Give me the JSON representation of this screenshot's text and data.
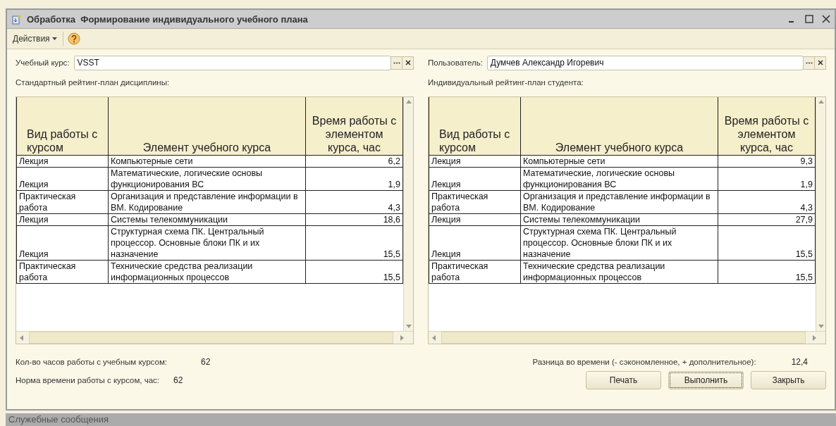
{
  "window": {
    "title_kind": "Обработка",
    "title": "Формирование индивидуального учебного плана"
  },
  "toolbar": {
    "actions_menu": "Действия"
  },
  "fields": [
    {
      "label": "Учебный курс:",
      "value": "VSST"
    },
    {
      "label": "Пользователь:",
      "value": "Думчев Александр Игоревич"
    }
  ],
  "tables": [
    {
      "caption": "Стандартный рейтинг-план дисциплины:",
      "columns": [
        "Вид работы с курсом",
        "Элемент учебного курса",
        "Время работы с элементом курса, час"
      ],
      "rows": [
        [
          "Лекция",
          "Компьютерные сети",
          "6,2"
        ],
        [
          "Лекция",
          "Математические, логические основы функционирования ВС",
          "1,9"
        ],
        [
          "Практическая работа",
          "Организация и представление информации в ВМ. Кодирование",
          "4,3"
        ],
        [
          "Лекция",
          "Системы телекоммуникации",
          "18,6"
        ],
        [
          "Лекция",
          "Структурная схема ПК. Центральный процессор. Основные блоки ПК и их назначение",
          "15,5"
        ],
        [
          "Практическая работа",
          "Технические средства реализации информационных процессов",
          "15,5"
        ]
      ]
    },
    {
      "caption": "Индивидуальный рейтинг-план студента:",
      "columns": [
        "Вид работы с курсом",
        "Элемент учебного курса",
        "Время работы с элементом курса, час"
      ],
      "rows": [
        [
          "Лекция",
          "Компьютерные сети",
          "9,3"
        ],
        [
          "Лекция",
          "Математические, логические основы функционирования ВС",
          "1,9"
        ],
        [
          "Практическая работа",
          "Организация и представление информации в ВМ. Кодирование",
          "4,3"
        ],
        [
          "Лекция",
          "Системы телекоммуникации",
          "27,9"
        ],
        [
          "Лекция",
          "Структурная схема ПК. Центральный процессор. Основные блоки ПК и их назначение",
          "15,5"
        ],
        [
          "Практическая работа",
          "Технические средства реализации информационных процессов",
          "15,5"
        ]
      ]
    }
  ],
  "totals": [
    {
      "label": "Кол-во часов работы с учебным курсом:",
      "value": "62"
    },
    {
      "label": "Норма времени работы с курсом, час:",
      "value": "62"
    }
  ],
  "difference": {
    "label": "Разница во времени (- сэкономленное, + дополнительное):",
    "value": "12,4"
  },
  "buttons": [
    {
      "label": "Печать",
      "focused": false
    },
    {
      "label": "Выполнить",
      "focused": true
    },
    {
      "label": "Закрыть",
      "focused": false
    }
  ],
  "messages_panel": {
    "title": "Служебные сообщения"
  }
}
